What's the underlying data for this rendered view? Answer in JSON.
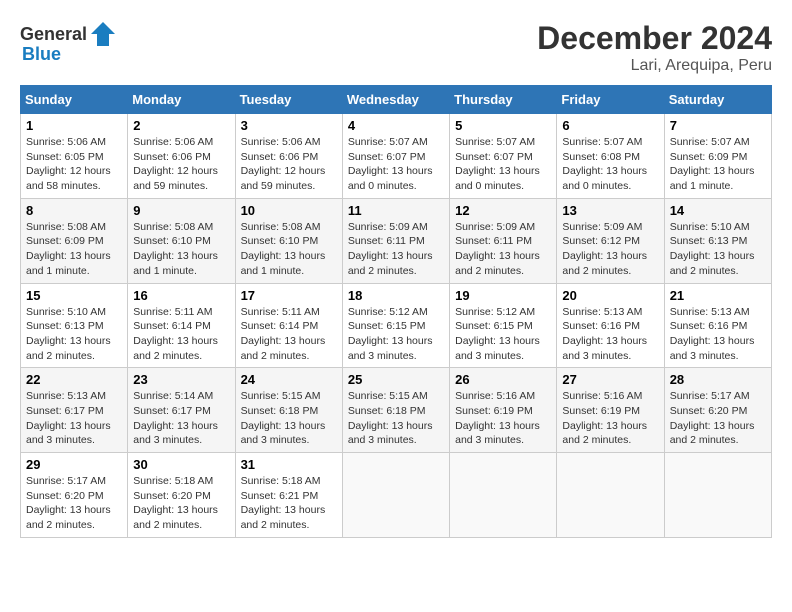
{
  "logo": {
    "general": "General",
    "blue": "Blue"
  },
  "title": "December 2024",
  "location": "Lari, Arequipa, Peru",
  "days_of_week": [
    "Sunday",
    "Monday",
    "Tuesday",
    "Wednesday",
    "Thursday",
    "Friday",
    "Saturday"
  ],
  "weeks": [
    [
      {
        "day": "1",
        "sunrise": "5:06 AM",
        "sunset": "6:05 PM",
        "daylight": "12 hours and 58 minutes."
      },
      {
        "day": "2",
        "sunrise": "5:06 AM",
        "sunset": "6:06 PM",
        "daylight": "12 hours and 59 minutes."
      },
      {
        "day": "3",
        "sunrise": "5:06 AM",
        "sunset": "6:06 PM",
        "daylight": "12 hours and 59 minutes."
      },
      {
        "day": "4",
        "sunrise": "5:07 AM",
        "sunset": "6:07 PM",
        "daylight": "13 hours and 0 minutes."
      },
      {
        "day": "5",
        "sunrise": "5:07 AM",
        "sunset": "6:07 PM",
        "daylight": "13 hours and 0 minutes."
      },
      {
        "day": "6",
        "sunrise": "5:07 AM",
        "sunset": "6:08 PM",
        "daylight": "13 hours and 0 minutes."
      },
      {
        "day": "7",
        "sunrise": "5:07 AM",
        "sunset": "6:09 PM",
        "daylight": "13 hours and 1 minute."
      }
    ],
    [
      {
        "day": "8",
        "sunrise": "5:08 AM",
        "sunset": "6:09 PM",
        "daylight": "13 hours and 1 minute."
      },
      {
        "day": "9",
        "sunrise": "5:08 AM",
        "sunset": "6:10 PM",
        "daylight": "13 hours and 1 minute."
      },
      {
        "day": "10",
        "sunrise": "5:08 AM",
        "sunset": "6:10 PM",
        "daylight": "13 hours and 1 minute."
      },
      {
        "day": "11",
        "sunrise": "5:09 AM",
        "sunset": "6:11 PM",
        "daylight": "13 hours and 2 minutes."
      },
      {
        "day": "12",
        "sunrise": "5:09 AM",
        "sunset": "6:11 PM",
        "daylight": "13 hours and 2 minutes."
      },
      {
        "day": "13",
        "sunrise": "5:09 AM",
        "sunset": "6:12 PM",
        "daylight": "13 hours and 2 minutes."
      },
      {
        "day": "14",
        "sunrise": "5:10 AM",
        "sunset": "6:13 PM",
        "daylight": "13 hours and 2 minutes."
      }
    ],
    [
      {
        "day": "15",
        "sunrise": "5:10 AM",
        "sunset": "6:13 PM",
        "daylight": "13 hours and 2 minutes."
      },
      {
        "day": "16",
        "sunrise": "5:11 AM",
        "sunset": "6:14 PM",
        "daylight": "13 hours and 2 minutes."
      },
      {
        "day": "17",
        "sunrise": "5:11 AM",
        "sunset": "6:14 PM",
        "daylight": "13 hours and 2 minutes."
      },
      {
        "day": "18",
        "sunrise": "5:12 AM",
        "sunset": "6:15 PM",
        "daylight": "13 hours and 3 minutes."
      },
      {
        "day": "19",
        "sunrise": "5:12 AM",
        "sunset": "6:15 PM",
        "daylight": "13 hours and 3 minutes."
      },
      {
        "day": "20",
        "sunrise": "5:13 AM",
        "sunset": "6:16 PM",
        "daylight": "13 hours and 3 minutes."
      },
      {
        "day": "21",
        "sunrise": "5:13 AM",
        "sunset": "6:16 PM",
        "daylight": "13 hours and 3 minutes."
      }
    ],
    [
      {
        "day": "22",
        "sunrise": "5:13 AM",
        "sunset": "6:17 PM",
        "daylight": "13 hours and 3 minutes."
      },
      {
        "day": "23",
        "sunrise": "5:14 AM",
        "sunset": "6:17 PM",
        "daylight": "13 hours and 3 minutes."
      },
      {
        "day": "24",
        "sunrise": "5:15 AM",
        "sunset": "6:18 PM",
        "daylight": "13 hours and 3 minutes."
      },
      {
        "day": "25",
        "sunrise": "5:15 AM",
        "sunset": "6:18 PM",
        "daylight": "13 hours and 3 minutes."
      },
      {
        "day": "26",
        "sunrise": "5:16 AM",
        "sunset": "6:19 PM",
        "daylight": "13 hours and 3 minutes."
      },
      {
        "day": "27",
        "sunrise": "5:16 AM",
        "sunset": "6:19 PM",
        "daylight": "13 hours and 2 minutes."
      },
      {
        "day": "28",
        "sunrise": "5:17 AM",
        "sunset": "6:20 PM",
        "daylight": "13 hours and 2 minutes."
      }
    ],
    [
      {
        "day": "29",
        "sunrise": "5:17 AM",
        "sunset": "6:20 PM",
        "daylight": "13 hours and 2 minutes."
      },
      {
        "day": "30",
        "sunrise": "5:18 AM",
        "sunset": "6:20 PM",
        "daylight": "13 hours and 2 minutes."
      },
      {
        "day": "31",
        "sunrise": "5:18 AM",
        "sunset": "6:21 PM",
        "daylight": "13 hours and 2 minutes."
      },
      null,
      null,
      null,
      null
    ]
  ]
}
